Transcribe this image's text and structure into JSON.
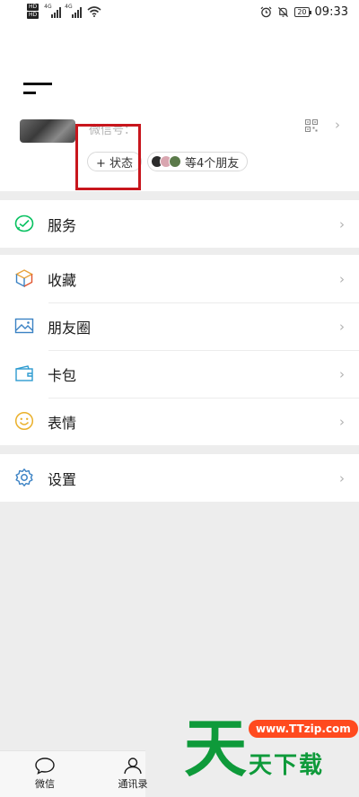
{
  "status_bar": {
    "hd_labels": [
      "HD",
      "HD"
    ],
    "signal_gen": [
      "4G",
      "4G"
    ],
    "battery": "20",
    "time": "09:33"
  },
  "profile": {
    "wechat_id_label": "微信号：",
    "status_button": "+ 状态",
    "friends_text": "等4个朋友",
    "arrow": "›"
  },
  "menu": {
    "service": "服务",
    "favorites": "收藏",
    "moments": "朋友圈",
    "cards": "卡包",
    "stickers": "表情",
    "settings": "设置",
    "arrow": "›"
  },
  "bottom_nav": {
    "chats": "微信",
    "contacts": "通讯录"
  },
  "watermark": {
    "big": "天",
    "url": "www.TTzip.com",
    "text": "天下载"
  },
  "colors": {
    "accent_green": "#07c160",
    "highlight_red": "#c8161d",
    "background": "#ededed"
  }
}
